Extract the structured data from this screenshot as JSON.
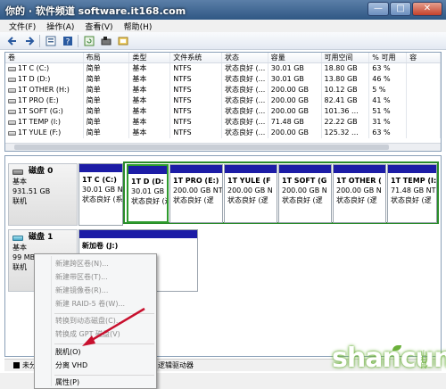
{
  "window": {
    "title": "你的 · 软件频道 software.it168.com",
    "buttons": [
      "—",
      "□",
      "✕"
    ]
  },
  "menu": [
    "文件(F)",
    "操作(A)",
    "查看(V)",
    "帮助(H)"
  ],
  "toolbar": [
    "back-icon",
    "forward-icon",
    "properties-icon",
    "help-icon",
    "refresh-icon",
    "connect-disk-icon",
    "export-icon"
  ],
  "volume_list": {
    "headers": [
      "卷",
      "布局",
      "类型",
      "文件系统",
      "状态",
      "容量",
      "可用空间",
      "% 可用",
      "容"
    ],
    "rows": [
      [
        "1T C (C:)",
        "简单",
        "基本",
        "NTFS",
        "状态良好 (...",
        "30.01 GB",
        "18.80 GB",
        "63 %",
        ""
      ],
      [
        "1T D (D:)",
        "简单",
        "基本",
        "NTFS",
        "状态良好 (...",
        "30.01 GB",
        "13.80 GB",
        "46 %",
        ""
      ],
      [
        "1T OTHER (H:)",
        "简单",
        "基本",
        "NTFS",
        "状态良好 (...",
        "200.00 GB",
        "10.12 GB",
        "5 %",
        ""
      ],
      [
        "1T PRO (E:)",
        "简单",
        "基本",
        "NTFS",
        "状态良好 (...",
        "200.00 GB",
        "82.41 GB",
        "41 %",
        ""
      ],
      [
        "1T SOFT (G:)",
        "简单",
        "基本",
        "NTFS",
        "状态良好 (...",
        "200.00 GB",
        "101.36 ...",
        "51 %",
        ""
      ],
      [
        "1T TEMP (I:)",
        "简单",
        "基本",
        "NTFS",
        "状态良好 (...",
        "71.48 GB",
        "22.22 GB",
        "31 %",
        ""
      ],
      [
        "1T YULE (F:)",
        "简单",
        "基本",
        "NTFS",
        "状态良好 (...",
        "200.00 GB",
        "125.32 ...",
        "63 %",
        ""
      ]
    ]
  },
  "disks": [
    {
      "name": "磁盘 0",
      "type": "基本",
      "size": "931.51 GB",
      "status": "联机",
      "partitions": [
        {
          "name": "1T C  (C:)",
          "size": "30.01 GB NT",
          "state": "状态良好 (系"
        },
        {
          "name": "1T D  (D:",
          "size": "30.01 GB N",
          "state": "状态良好 (逻"
        },
        {
          "name": "1T PRO  (E:)",
          "size": "200.00 GB NT",
          "state": "状态良好 (逻"
        },
        {
          "name": "1T YULE  (F",
          "size": "200.00 GB N",
          "state": "状态良好 (逻"
        },
        {
          "name": "1T SOFT  (G",
          "size": "200.00 GB N",
          "state": "状态良好 (逻"
        },
        {
          "name": "1T OTHER  (",
          "size": "200.00 GB N",
          "state": "状态良好 (逻"
        },
        {
          "name": "1T TEMP  (I:",
          "size": "71.48 GB NT",
          "state": "状态良好 (逻"
        }
      ]
    },
    {
      "name": "磁盘 1",
      "type": "基本",
      "size": "99 MB",
      "status": "联机",
      "partitions": [
        {
          "name": "新加卷  (J:)",
          "size": "",
          "state": ""
        }
      ]
    }
  ],
  "legend": [
    {
      "label": "未分",
      "color": "#000000"
    },
    {
      "label": "逻辑驱动器",
      "color": "#1c1ca6"
    }
  ],
  "context_menu": {
    "items": [
      {
        "label": "新建跨区卷(N)...",
        "enabled": false
      },
      {
        "label": "新建带区卷(T)...",
        "enabled": false
      },
      {
        "label": "新建镜像卷(R)...",
        "enabled": false
      },
      {
        "label": "新建 RAID-5 卷(W)...",
        "enabled": false
      },
      {
        "label": "转换到动态磁盘(C)...",
        "enabled": false
      },
      {
        "label": "转换成 GPT 磁盘(V)",
        "enabled": false
      },
      {
        "label": "脱机(O)",
        "enabled": true
      },
      {
        "label": "分离 VHD",
        "enabled": true
      },
      {
        "label": "属性(P)",
        "enabled": true
      }
    ]
  },
  "watermark": {
    "text": "shancun",
    "sub": "山村网"
  }
}
